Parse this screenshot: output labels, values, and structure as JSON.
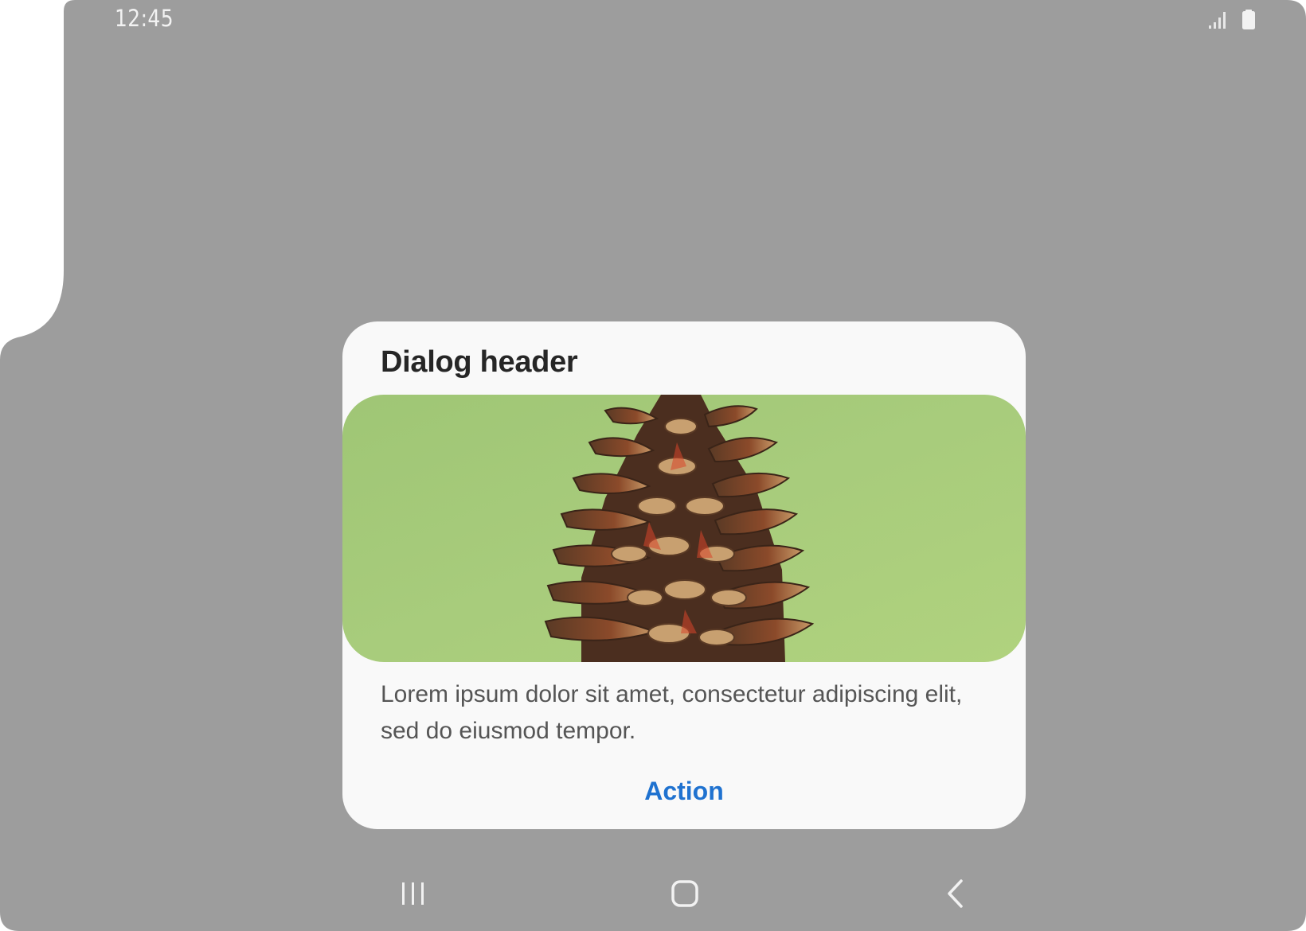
{
  "status_bar": {
    "time": "12:45",
    "signal_icon": "signal-icon",
    "battery_icon": "battery-icon"
  },
  "dialog": {
    "title": "Dialog header",
    "image": "pine-cone-photo",
    "body": "Lorem ipsum dolor sit amet, consectetur adipiscing elit, sed do eiusmod tempor.",
    "action_label": "Action"
  },
  "nav_bar": {
    "recents_icon": "recents-icon",
    "home_icon": "home-icon",
    "back_icon": "back-icon"
  },
  "colors": {
    "scrim": "#9d9d9d",
    "dialog_background": "#f9f9f9",
    "title": "#262626",
    "body_text": "#555555",
    "action": "#1f72d0",
    "image_background": "#a6c878"
  }
}
